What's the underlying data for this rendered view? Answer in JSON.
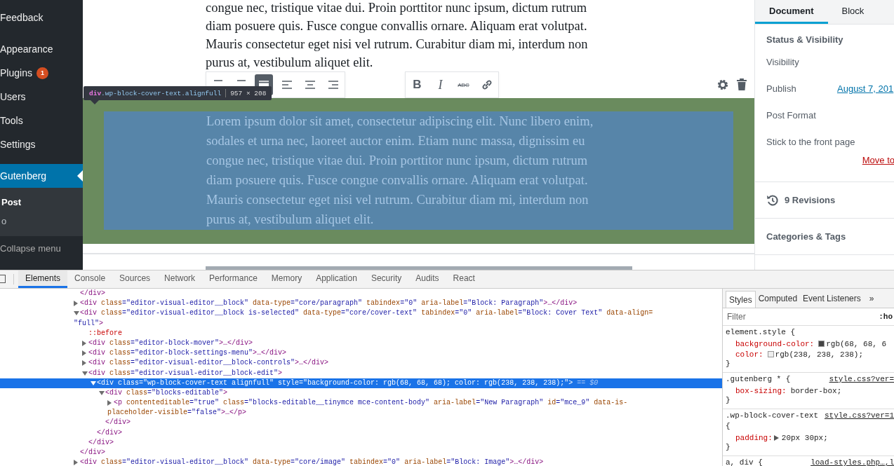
{
  "admin_menu": {
    "groups": [
      {
        "items": [
          {
            "label": "Feedback",
            "selected": false
          }
        ]
      },
      {
        "items": [
          {
            "label": "Appearance",
            "selected": false
          },
          {
            "label": "Plugins",
            "selected": false,
            "badge": "1"
          },
          {
            "label": "Users",
            "selected": false
          },
          {
            "label": "Tools",
            "selected": false
          },
          {
            "label": "Settings",
            "selected": false
          }
        ]
      },
      {
        "items": [
          {
            "label": "Gutenberg",
            "selected": true
          }
        ]
      }
    ],
    "submenu": [
      {
        "label": "Post",
        "selected": true
      },
      {
        "label": "o",
        "selected": false
      }
    ],
    "collapse": "Collapse menu"
  },
  "editor": {
    "paragraph": "congue nec, tristique vitae dui. Proin porttitor nunc ipsum, dictum rutrum diam posuere quis. Fusce congue convallis ornare. Aliquam erat volutpat. Mauris consectetur eget nisi vel rutrum. Curabitur diam mi, interdum non purus at, vestibulum aliquet elit.",
    "block_toolbar": [
      {
        "kind": "lines",
        "selected": false
      },
      {
        "kind": "lines",
        "selected": false
      },
      {
        "kind": "full",
        "selected": true
      },
      {
        "kind": "left",
        "selected": false
      },
      {
        "kind": "center",
        "selected": false
      },
      {
        "kind": "right",
        "selected": false
      }
    ],
    "format_toolbar": [
      {
        "kind": "bold",
        "label": "B"
      },
      {
        "kind": "italic",
        "label": "I"
      },
      {
        "kind": "strike",
        "label": "ABC"
      },
      {
        "kind": "link"
      }
    ],
    "inspect_tooltip": {
      "tag": "div",
      "classes": ".wp-block-cover-text.alignfull",
      "size": "957 × 208"
    },
    "cover_text": "Lorem ipsum dolor sit amet, consectetur adipiscing elit. Nunc libero enim, sodales et urna nec, laoreet auctor enim. Etiam nunc massa, dignissim eu congue nec, tristique vitae dui. Proin porttitor nunc ipsum, dictum rutrum diam posuere quis. Fusce congue convallis ornare. Aliquam erat volutpat. Mauris consectetur eget nisi vel rutrum. Curabitur diam mi, interdum non purus at, vestibulum aliquet elit."
  },
  "settings_panel": {
    "tabs": [
      {
        "label": "Document",
        "selected": true
      },
      {
        "label": "Block",
        "selected": false
      }
    ],
    "status_title": "Status & Visibility",
    "rows": [
      {
        "label": "Visibility"
      },
      {
        "label": "Publish",
        "link": "August 7, 201"
      },
      {
        "label": "Post Format"
      },
      {
        "label": "Stick to the front page"
      }
    ],
    "trash_link": "Move to",
    "revisions": "9 Revisions",
    "categories": "Categories & Tags"
  },
  "devtools": {
    "tabs": [
      {
        "label": "Elements",
        "selected": true
      },
      {
        "label": "Console",
        "selected": false
      },
      {
        "label": "Sources",
        "selected": false
      },
      {
        "label": "Network",
        "selected": false
      },
      {
        "label": "Performance",
        "selected": false
      },
      {
        "label": "Memory",
        "selected": false
      },
      {
        "label": "Application",
        "selected": false
      },
      {
        "label": "Security",
        "selected": false
      },
      {
        "label": "Audits",
        "selected": false
      },
      {
        "label": "React",
        "selected": false
      }
    ],
    "nodes": [
      {
        "selected": false,
        "tokens": [
          {
            "kind": "tag",
            "text": "</div>"
          }
        ]
      },
      {
        "selected": false,
        "expanded": false,
        "tokens": [
          {
            "kind": "tag",
            "text": "<div"
          },
          {
            "kind": "attr",
            "text": " class"
          },
          {
            "kind": "value",
            "text": "=\"editor-visual-editor__block\""
          },
          {
            "kind": "attr",
            "text": " data-type"
          },
          {
            "kind": "value",
            "text": "=\"core/paragraph\""
          },
          {
            "kind": "attr",
            "text": " tabindex"
          },
          {
            "kind": "value",
            "text": "=\"0\""
          },
          {
            "kind": "attr",
            "text": " aria-label"
          },
          {
            "kind": "value",
            "text": "=\"Block: Paragraph\""
          },
          {
            "kind": "tag",
            "text": ">…</div>"
          }
        ]
      },
      {
        "selected": false,
        "expanded": true,
        "tokens": [
          {
            "kind": "tag",
            "text": "<div"
          },
          {
            "kind": "attr",
            "text": " class"
          },
          {
            "kind": "value",
            "text": "=\"editor-visual-editor__block is-selected\""
          },
          {
            "kind": "attr",
            "text": " data-type"
          },
          {
            "kind": "value",
            "text": "=\"core/cover-text\""
          },
          {
            "kind": "attr",
            "text": " tabindex"
          },
          {
            "kind": "value",
            "text": "=\"0\""
          },
          {
            "kind": "attr",
            "text": " aria-label"
          },
          {
            "kind": "value",
            "text": "=\"Block: Cover Text\""
          },
          {
            "kind": "attr",
            "text": " data-align="
          }
        ],
        "continuation": [
          {
            "kind": "value",
            "text": "\"full\""
          },
          {
            "kind": "tag",
            "text": ">"
          }
        ],
        "children": [
          {
            "selected": false,
            "tokens": [
              {
                "kind": "pseudo",
                "text": "::before"
              }
            ]
          },
          {
            "selected": false,
            "expanded": false,
            "tokens": [
              {
                "kind": "tag",
                "text": "<div"
              },
              {
                "kind": "attr",
                "text": " class"
              },
              {
                "kind": "value",
                "text": "=\"editor-block-mover\""
              },
              {
                "kind": "tag",
                "text": ">…</div>"
              }
            ]
          },
          {
            "selected": false,
            "expanded": false,
            "tokens": [
              {
                "kind": "tag",
                "text": "<div"
              },
              {
                "kind": "attr",
                "text": " class"
              },
              {
                "kind": "value",
                "text": "=\"editor-block-settings-menu\""
              },
              {
                "kind": "tag",
                "text": ">…</div>"
              }
            ]
          },
          {
            "selected": false,
            "expanded": false,
            "tokens": [
              {
                "kind": "tag",
                "text": "<div"
              },
              {
                "kind": "attr",
                "text": " class"
              },
              {
                "kind": "value",
                "text": "=\"editor-visual-editor__block-controls\""
              },
              {
                "kind": "tag",
                "text": ">…</div>"
              }
            ]
          },
          {
            "selected": false,
            "expanded": true,
            "tokens": [
              {
                "kind": "tag",
                "text": "<div"
              },
              {
                "kind": "attr",
                "text": " class"
              },
              {
                "kind": "value",
                "text": "=\"editor-visual-editor__block-edit\""
              },
              {
                "kind": "tag",
                "text": ">"
              }
            ],
            "children": [
              {
                "selected": true,
                "expanded": true,
                "tokens": [
                  {
                    "kind": "tag",
                    "text": "<div"
                  },
                  {
                    "kind": "attr",
                    "text": " class"
                  },
                  {
                    "kind": "value",
                    "text": "=\"wp-block-cover-text alignfull\""
                  },
                  {
                    "kind": "attr",
                    "text": " style"
                  },
                  {
                    "kind": "value",
                    "text": "=\"background-color: rgb(68, 68, 68); color: rgb(238, 238, 238);\""
                  },
                  {
                    "kind": "tag",
                    "text": ">"
                  },
                  {
                    "kind": "hint",
                    "text": " == $0"
                  }
                ],
                "children": [
                  {
                    "selected": false,
                    "expanded": true,
                    "tokens": [
                      {
                        "kind": "tag",
                        "text": "<div"
                      },
                      {
                        "kind": "attr",
                        "text": " class"
                      },
                      {
                        "kind": "value",
                        "text": "=\"blocks-editable\""
                      },
                      {
                        "kind": "tag",
                        "text": ">"
                      }
                    ],
                    "children": [
                      {
                        "selected": false,
                        "expanded": false,
                        "tokens": [
                          {
                            "kind": "tag",
                            "text": "<p"
                          },
                          {
                            "kind": "attr",
                            "text": " contenteditable"
                          },
                          {
                            "kind": "value",
                            "text": "=\"true\""
                          },
                          {
                            "kind": "attr",
                            "text": " class"
                          },
                          {
                            "kind": "value",
                            "text": "=\"blocks-editable__tinymce mce-content-body\""
                          },
                          {
                            "kind": "attr",
                            "text": " aria-label"
                          },
                          {
                            "kind": "value",
                            "text": "=\"New Paragraph\""
                          },
                          {
                            "kind": "attr",
                            "text": " id"
                          },
                          {
                            "kind": "value",
                            "text": "=\"mce_9\""
                          },
                          {
                            "kind": "attr",
                            "text": " data-is-"
                          }
                        ],
                        "continuation": [
                          {
                            "kind": "attr",
                            "text": "placeholder-visible"
                          },
                          {
                            "kind": "value",
                            "text": "=\"false\""
                          },
                          {
                            "kind": "tag",
                            "text": ">…</p>"
                          }
                        ]
                      }
                    ],
                    "close": "</div>"
                  }
                ],
                "close": "</div>"
              }
            ],
            "close": "</div>"
          }
        ],
        "close": "</div>"
      },
      {
        "selected": false,
        "expanded": false,
        "tokens": [
          {
            "kind": "tag",
            "text": "<div"
          },
          {
            "kind": "attr",
            "text": " class"
          },
          {
            "kind": "value",
            "text": "=\"editor-visual-editor__block\""
          },
          {
            "kind": "attr",
            "text": " data-type"
          },
          {
            "kind": "value",
            "text": "=\"core/image\""
          },
          {
            "kind": "attr",
            "text": " tabindex"
          },
          {
            "kind": "value",
            "text": "=\"0\""
          },
          {
            "kind": "attr",
            "text": " aria-label"
          },
          {
            "kind": "value",
            "text": "=\"Block: Image\""
          },
          {
            "kind": "tag",
            "text": ">…</div>"
          }
        ]
      }
    ],
    "styles": {
      "tabs": [
        {
          "label": "Styles",
          "selected": true
        },
        {
          "label": "Computed",
          "selected": false
        },
        {
          "label": "Event Listeners",
          "selected": false
        }
      ],
      "more": "»",
      "filter_placeholder": "Filter",
      "hov": ":ho",
      "rules": [
        {
          "selector": "element.style {",
          "props": [
            {
              "name": "background-color:",
              "value": "rgb(68, 68, 6",
              "color": "#444444"
            },
            {
              "name": "color:",
              "value": "rgb(238, 238, 238);",
              "color": "#eeeeee"
            }
          ],
          "close": "}"
        },
        {
          "selector": ".gutenberg * {",
          "source": "style.css?ver=",
          "props": [
            {
              "name": "box-sizing:",
              "value": "border-box;"
            }
          ],
          "close": "}"
        },
        {
          "selector": ".wp-block-cover-text",
          "source": "style.css?ver=1",
          "brace": "{",
          "props": [
            {
              "name": "padding:",
              "value": "20px 30px;",
              "expandable": true
            }
          ],
          "close": "}"
        },
        {
          "selector": "a, div {",
          "source": "load-styles.php…,l"
        }
      ]
    }
  }
}
